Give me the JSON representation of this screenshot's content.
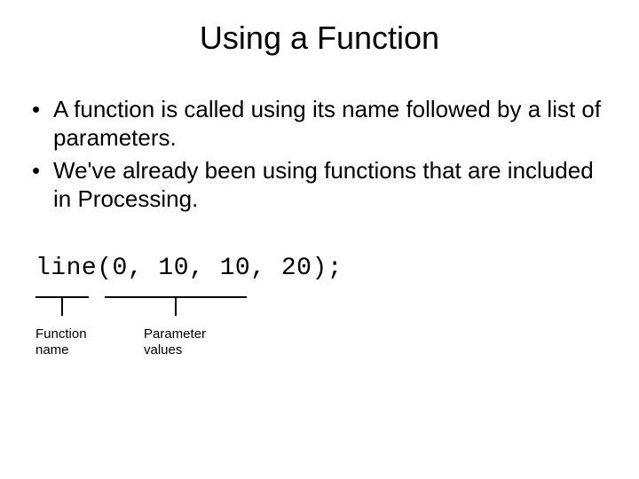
{
  "title": "Using a Function",
  "bullets": [
    "A function is called using its name followed by a list of parameters.",
    "We've already been using functions that are included in Processing."
  ],
  "code": "line(0, 10, 10, 20);",
  "annotations": {
    "function_name": "Function\nname",
    "parameter_values": "Parameter\nvalues"
  }
}
